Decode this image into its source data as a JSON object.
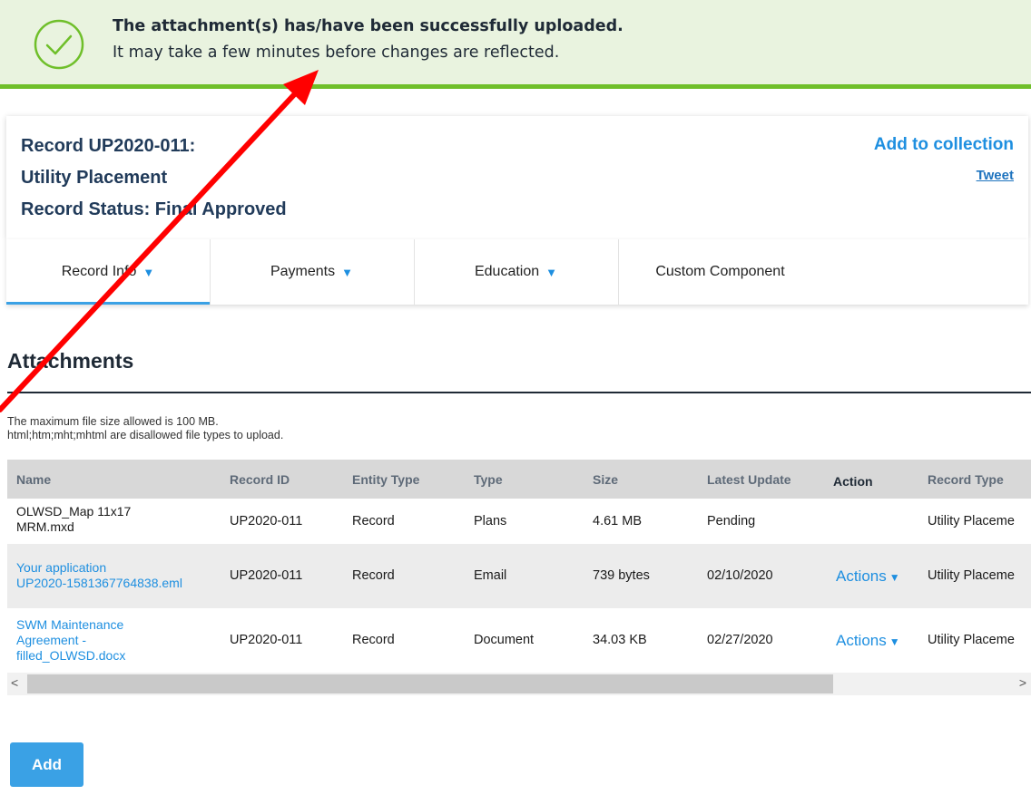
{
  "banner": {
    "title": "The attachment(s) has/have been successfully uploaded.",
    "subtitle": "It may take a few minutes before changes are reflected."
  },
  "record": {
    "id_line": "Record UP2020-011:",
    "type_line": "Utility Placement",
    "status_line": "Record Status: Final Approved",
    "add_to_collection": "Add to collection",
    "tweet": "Tweet"
  },
  "tabs": [
    {
      "label": "Record Info",
      "dropdown": true
    },
    {
      "label": "Payments",
      "dropdown": true
    },
    {
      "label": "Education",
      "dropdown": true
    },
    {
      "label": "Custom Component",
      "dropdown": false
    }
  ],
  "attachments": {
    "title": "Attachments",
    "note_size": "The maximum file size allowed is 100 MB.",
    "note_types": "html;htm;mht;mhtml are disallowed file types to upload.",
    "columns": [
      "Name",
      "Record ID",
      "Entity Type",
      "Type",
      "Size",
      "Latest Update",
      "Action",
      "Record Type"
    ],
    "rows": [
      {
        "name_line1": "OLWSD_Map 11x17",
        "name_line2": "MRM.mxd",
        "name_line3": "",
        "record_id": "UP2020-011",
        "entity_type": "Record",
        "type": "Plans",
        "size": "4.61 MB",
        "latest_update": "Pending",
        "action": "",
        "record_type": "Utility Placeme"
      },
      {
        "name_line1": "Your application",
        "name_line2": "UP2020-1581367764838.eml",
        "name_line3": "",
        "record_id": "UP2020-011",
        "entity_type": "Record",
        "type": "Email",
        "size": "739 bytes",
        "latest_update": "02/10/2020",
        "action": "Actions",
        "record_type": "Utility Placeme"
      },
      {
        "name_line1": "SWM Maintenance",
        "name_line2": "Agreement -",
        "name_line3": "filled_OLWSD.docx",
        "record_id": "UP2020-011",
        "entity_type": "Record",
        "type": "Document",
        "size": "34.03 KB",
        "latest_update": "02/27/2020",
        "action": "Actions",
        "record_type": "Utility Placeme"
      }
    ],
    "add_button": "Add"
  },
  "icons": {
    "banner": "check-circle-icon",
    "dropdown": "caret-down-icon",
    "scroll_left": "chevron-left-icon",
    "scroll_right": "chevron-right-icon"
  },
  "colors": {
    "accent": "#1e8fe0",
    "success": "#6fbf2a",
    "banner_bg": "#e9f3df",
    "heading": "#213b5a",
    "annotation_arrow": "#ff0000"
  }
}
